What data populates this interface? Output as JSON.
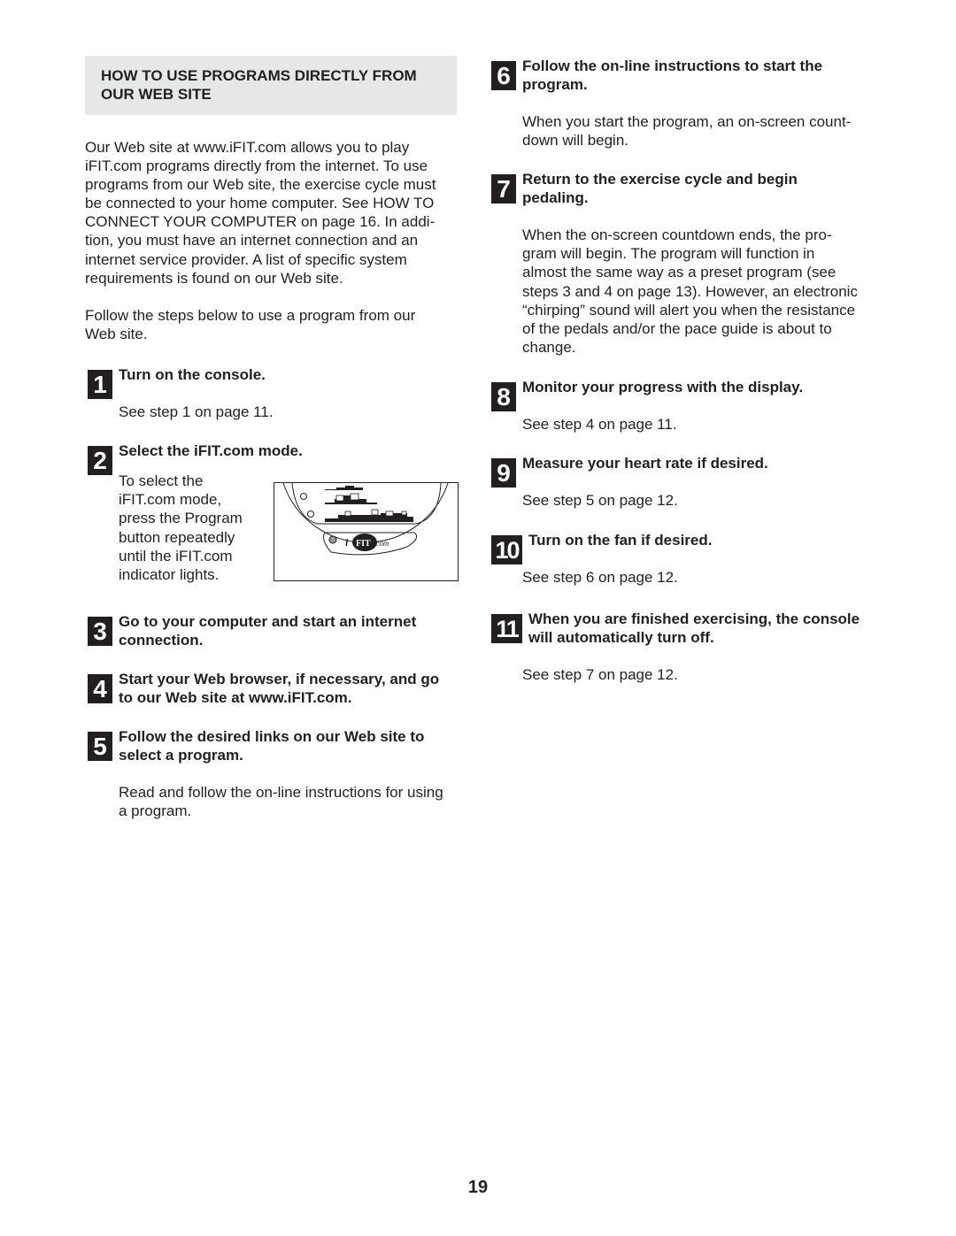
{
  "header": {
    "title_lines": [
      "HOW TO USE PROGRAMS DIRECTLY FROM",
      "OUR WEB SITE"
    ]
  },
  "intro": {
    "paragraph1_lines": [
      "Our Web site at www.iFIT.com allows you to play",
      "iFIT.com programs directly from the internet. To use",
      "programs from our Web site, the exercise cycle must",
      "be connected to your home computer. See HOW TO",
      "CONNECT YOUR COMPUTER on page 16. In addi-",
      "tion, you must have an internet connection and an",
      "internet service provider. A list of specific system",
      "requirements is found on our Web site."
    ],
    "paragraph2_lines": [
      "Follow the steps below to use a program from our",
      "Web site."
    ]
  },
  "steps": [
    {
      "number": "1",
      "title_lines": [
        "Turn on the console."
      ],
      "body_lines": [
        "See step 1 on page 11."
      ]
    },
    {
      "number": "2",
      "title_lines": [
        "Select the iFIT.com mode."
      ],
      "body_lines": [
        "To select the",
        "iFIT.com mode,",
        "press the Program",
        "button repeatedly",
        "until the iFIT.com",
        "indicator lights."
      ]
    },
    {
      "number": "3",
      "title_lines": [
        "Go to your computer and start an internet",
        "connection."
      ],
      "body_lines": []
    },
    {
      "number": "4",
      "title_lines": [
        "Start your Web browser, if necessary, and go",
        "to our Web site at www.iFIT.com."
      ],
      "body_lines": []
    },
    {
      "number": "5",
      "title_lines": [
        "Follow the desired links on our Web site to",
        "select a program."
      ],
      "body_lines": [
        "Read and follow the on-line instructions for using",
        "a program."
      ]
    },
    {
      "number": "6",
      "title_lines": [
        "Follow the on-line instructions to start the",
        "program."
      ],
      "body_lines": [
        "When you start the program, an on-screen count-",
        "down will begin."
      ]
    },
    {
      "number": "7",
      "title_lines": [
        "Return to the exercise cycle and begin",
        "pedaling."
      ],
      "body_lines": [
        "When the on-screen countdown ends, the pro-",
        "gram will begin. The program will function in",
        "almost the same way as a preset program (see",
        "steps 3 and 4 on page 13). However, an electronic",
        "“chirping” sound will alert you when the resistance",
        "of the pedals and/or the pace guide is about to",
        "change."
      ]
    },
    {
      "number": "8",
      "title_lines": [
        "Monitor your progress with the display."
      ],
      "body_lines": [
        "See step 4 on page 11."
      ]
    },
    {
      "number": "9",
      "title_lines": [
        "Measure your heart rate if desired."
      ],
      "body_lines": [
        "See step 5 on page 12."
      ]
    },
    {
      "number": "10",
      "title_lines": [
        "Turn on the fan if desired."
      ],
      "body_lines": [
        "See step 6 on page 12."
      ]
    },
    {
      "number": "11",
      "title_lines": [
        "When you are finished exercising, the console",
        "will automatically turn off."
      ],
      "body_lines": [
        "See step 7 on page 12."
      ]
    }
  ],
  "figure": {
    "logo_text_i": "i",
    "logo_text_fit": "FIT",
    "logo_text_com": ".com"
  },
  "footer": {
    "page_number": "19"
  }
}
